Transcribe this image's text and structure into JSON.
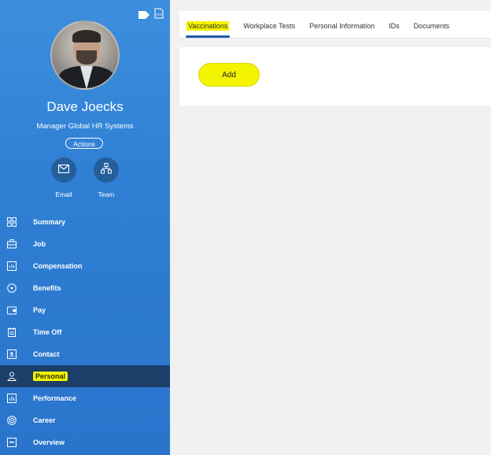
{
  "profile": {
    "name": "Dave Joecks",
    "title": "Manager Global HR Systems",
    "actions_label": "Actions",
    "email_label": "Email",
    "team_label": "Team"
  },
  "sidebar": {
    "items": [
      {
        "label": "Summary",
        "icon": "summary-icon"
      },
      {
        "label": "Job",
        "icon": "job-icon"
      },
      {
        "label": "Compensation",
        "icon": "compensation-icon"
      },
      {
        "label": "Benefits",
        "icon": "benefits-icon"
      },
      {
        "label": "Pay",
        "icon": "pay-icon"
      },
      {
        "label": "Time Off",
        "icon": "time-off-icon"
      },
      {
        "label": "Contact",
        "icon": "contact-icon"
      },
      {
        "label": "Personal",
        "icon": "person-icon",
        "active": true
      },
      {
        "label": "Performance",
        "icon": "performance-icon"
      },
      {
        "label": "Career",
        "icon": "career-icon"
      },
      {
        "label": "Overview",
        "icon": "overview-icon"
      }
    ]
  },
  "tabs": [
    {
      "label": "Vaccinations",
      "active": true
    },
    {
      "label": "Workplace Tests"
    },
    {
      "label": "Personal Information"
    },
    {
      "label": "IDs"
    },
    {
      "label": "Documents"
    }
  ],
  "panel": {
    "add_label": "Add"
  },
  "colors": {
    "sidebar_top": "#3d8fdd",
    "sidebar_bottom": "#2a74cc",
    "active_nav": "#1c3f6a",
    "highlight": "#f4f400",
    "tab_underline": "#1f5aa8"
  },
  "top_icons": [
    "tag-icon",
    "pdf-icon"
  ]
}
